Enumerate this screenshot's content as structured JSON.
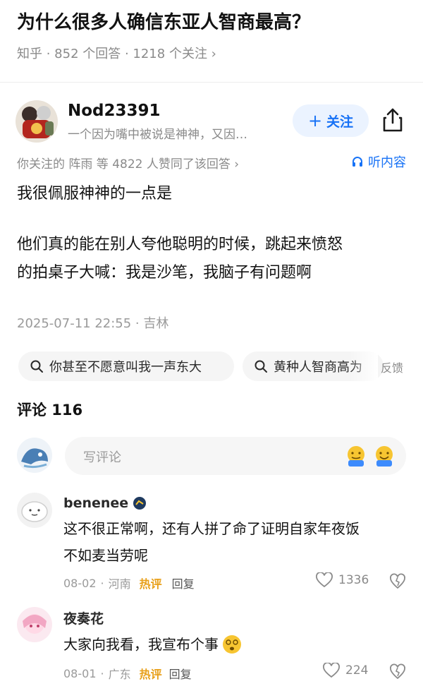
{
  "question": {
    "title": "为什么很多人确信东亚人智商最高？",
    "meta": "知乎 · 852 个回答 · 1218 个关注 ›"
  },
  "author": {
    "name": "Nod23391",
    "bio": "一个因为嘴中被说是神神，又因…",
    "follow_label": "关注",
    "voters": "你关注的 阵雨 等 4822 人赞同了该回答 ›",
    "listen_label": "听内容"
  },
  "answer": {
    "p1": "我很佩服神神的一点是",
    "p2_l1": "他们真的能在别人夸他聪明的时候，跳起来愤怒",
    "p2_l2": "的拍桌子大喊：我是沙笔，我脑子有问题啊",
    "time": "2025-07-11 22:55 · 吉林"
  },
  "search_chips": [
    "你甚至不愿意叫我一声东大",
    "黄种人智商高为"
  ],
  "feedback_label": "反馈",
  "comments": {
    "header": "评论 116",
    "placeholder": "写评论",
    "emoji_labels": [
      "递递",
      "赞同"
    ],
    "items": [
      {
        "name": "benenee",
        "line1": "这不很正常啊，还有人拼了命了证明自家年夜饭",
        "line2": "不如麦当劳呢",
        "date": "08-02",
        "location": "河南",
        "hot": "热评",
        "reply": "回复",
        "likes": "1336"
      },
      {
        "name": "夜奏花",
        "line1": "大家向我看，我宣布个事",
        "date": "08-01",
        "location": "广东",
        "hot": "热评",
        "reply": "回复",
        "likes": "224"
      }
    ]
  },
  "colors": {
    "accent": "#1772f6",
    "hot": "#e8a01a",
    "muted": "#8a8a8a"
  },
  "icons": [
    "share-icon",
    "headphones-icon",
    "search-icon",
    "heart-icon",
    "dislike-icon"
  ]
}
